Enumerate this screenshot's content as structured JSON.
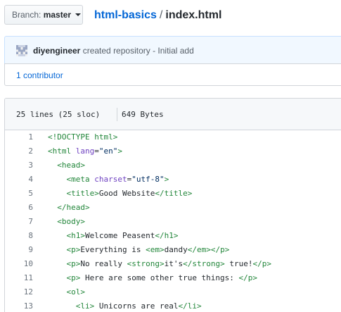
{
  "branch": {
    "label": "Branch:",
    "value": "master"
  },
  "breadcrumb": {
    "repo": "html-basics",
    "separator": "/",
    "file": "index.html"
  },
  "commit": {
    "author": "diyengineer",
    "message": "created repository - Initial add",
    "avatar_icon": "identicon"
  },
  "contributors": {
    "label": "1 contributor"
  },
  "file_info": {
    "lines": "25 lines (25 sloc)",
    "size": "649 Bytes"
  },
  "code_lines": [
    {
      "num": "1",
      "parts": [
        {
          "t": "tg",
          "v": "<!DOCTYPE html>"
        }
      ]
    },
    {
      "num": "2",
      "parts": [
        {
          "t": "tg",
          "v": "<html"
        },
        {
          "t": "",
          "v": " "
        },
        {
          "t": "at",
          "v": "lang"
        },
        {
          "t": "",
          "v": "="
        },
        {
          "t": "st",
          "v": "\"en\""
        },
        {
          "t": "tg",
          "v": ">"
        }
      ]
    },
    {
      "num": "3",
      "parts": [
        {
          "t": "",
          "v": "  "
        },
        {
          "t": "tg",
          "v": "<head>"
        }
      ]
    },
    {
      "num": "4",
      "parts": [
        {
          "t": "",
          "v": "    "
        },
        {
          "t": "tg",
          "v": "<meta"
        },
        {
          "t": "",
          "v": " "
        },
        {
          "t": "at",
          "v": "charset"
        },
        {
          "t": "",
          "v": "="
        },
        {
          "t": "st",
          "v": "\"utf-8\""
        },
        {
          "t": "tg",
          "v": ">"
        }
      ]
    },
    {
      "num": "5",
      "parts": [
        {
          "t": "",
          "v": "    "
        },
        {
          "t": "tg",
          "v": "<title>"
        },
        {
          "t": "",
          "v": "Good Website"
        },
        {
          "t": "tg",
          "v": "</title>"
        }
      ]
    },
    {
      "num": "6",
      "parts": [
        {
          "t": "",
          "v": "  "
        },
        {
          "t": "tg",
          "v": "</head>"
        }
      ]
    },
    {
      "num": "7",
      "parts": [
        {
          "t": "",
          "v": "  "
        },
        {
          "t": "tg",
          "v": "<body>"
        }
      ]
    },
    {
      "num": "8",
      "parts": [
        {
          "t": "",
          "v": "    "
        },
        {
          "t": "tg",
          "v": "<h1>"
        },
        {
          "t": "",
          "v": "Welcome Peasent"
        },
        {
          "t": "tg",
          "v": "</h1>"
        }
      ]
    },
    {
      "num": "9",
      "parts": [
        {
          "t": "",
          "v": "    "
        },
        {
          "t": "tg",
          "v": "<p>"
        },
        {
          "t": "",
          "v": "Everything is "
        },
        {
          "t": "tg",
          "v": "<em>"
        },
        {
          "t": "",
          "v": "dandy"
        },
        {
          "t": "tg",
          "v": "</em></p>"
        }
      ]
    },
    {
      "num": "10",
      "parts": [
        {
          "t": "",
          "v": "    "
        },
        {
          "t": "tg",
          "v": "<p>"
        },
        {
          "t": "",
          "v": "No really "
        },
        {
          "t": "tg",
          "v": "<strong>"
        },
        {
          "t": "",
          "v": "it's"
        },
        {
          "t": "tg",
          "v": "</strong>"
        },
        {
          "t": "",
          "v": " true!"
        },
        {
          "t": "tg",
          "v": "</p>"
        }
      ]
    },
    {
      "num": "11",
      "parts": [
        {
          "t": "",
          "v": "    "
        },
        {
          "t": "tg",
          "v": "<p>"
        },
        {
          "t": "",
          "v": " Here are some other true things: "
        },
        {
          "t": "tg",
          "v": "</p>"
        }
      ]
    },
    {
      "num": "12",
      "parts": [
        {
          "t": "",
          "v": "    "
        },
        {
          "t": "tg",
          "v": "<ol>"
        }
      ]
    },
    {
      "num": "13",
      "parts": [
        {
          "t": "",
          "v": "      "
        },
        {
          "t": "tg",
          "v": "<li>"
        },
        {
          "t": "",
          "v": " Unicorns are real"
        },
        {
          "t": "tg",
          "v": "</li>"
        }
      ]
    }
  ]
}
